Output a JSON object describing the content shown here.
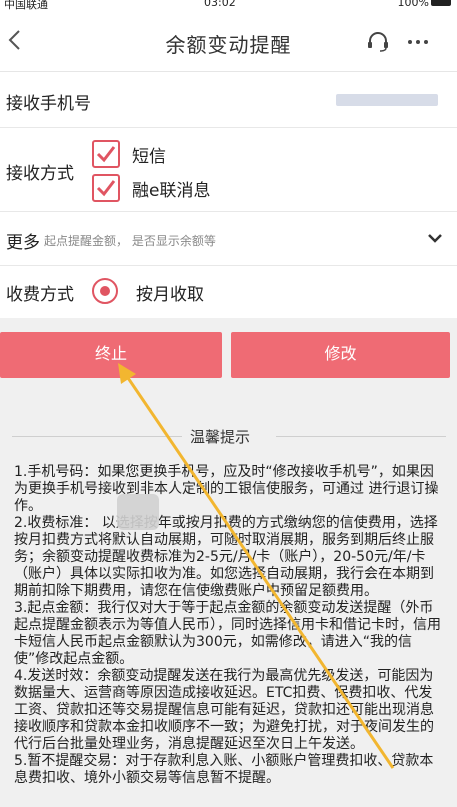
{
  "statusbar": {
    "carrier": "中国联通",
    "time": "03:02",
    "battery": "100%"
  },
  "header": {
    "title": "余额变动提醒"
  },
  "form": {
    "phone_label": "接收手机号",
    "method_label": "接收方式",
    "method_options": [
      {
        "label": "短信",
        "checked": true
      },
      {
        "label": "融e联消息",
        "checked": true
      }
    ],
    "more_label": "更多",
    "more_hint": "起点提醒金额， 是否显示余额等",
    "fee_label": "收费方式",
    "fee_option": "按月收取"
  },
  "buttons": {
    "stop": "终止",
    "edit": "修改"
  },
  "tips": {
    "title": "温馨提示",
    "paragraphs": [
      "1.手机号码：如果您更换手机号，应及时“修改接收手机号”，如果因为更换手机号接收到非本人定制的工银信使服务，可通过  进行退订操作。",
      "2.收费标准：  以选择按年或按月扣费的方式缴纳您的信使费用，选择按月扣费方式将默认自动展期，可随时取消展期，服务到期后终止服务；余额变动提醒收费标准为2-5元/月/卡（账户），20-50元/年/卡（账户）具体以实际扣收为准。如您选择自动展期，我行会在本期到期前扣除下期费用，请您在信使缴费账户中预留足额费用。",
      "3.起点金额：我行仅对大于等于起点金额的余额变动发送提醒（外币起点提醒金额表示为等值人民币），同时选择信用卡和借记卡时，信用卡短信人民币起点金额默认为300元，如需修改，请进入“我的信使”修改起点金额。",
      "4.发送时效：余额变动提醒发送在我行为最高优先级发送，可能因为数据量大、运营商等原因造成接收延迟。ETC扣费、保费扣收、代发工资、贷款扣还等交易提醒信息可能有延迟，贷款扣还可能出现消息接收顺序和贷款本金扣收顺序不一致；为避免打扰，对于夜间发生的代行后台批量处理业务，消息提醒延迟至次日上午发送。",
      "5.暂不提醒交易：对于存款利息入账、小额账户管理费扣收、贷款本息费扣收、境外小额交易等信息暂不提醒。"
    ]
  },
  "colors": {
    "accent": "#e05562",
    "button": "#ef6b74",
    "arrow": "#f2b630"
  }
}
